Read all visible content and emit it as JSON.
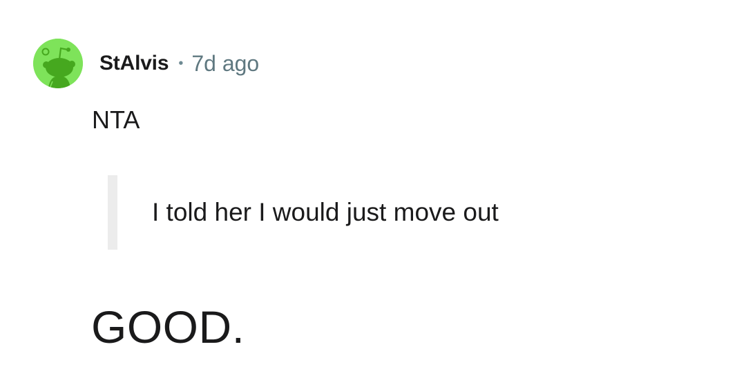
{
  "comment": {
    "avatar_icon": "reddit-snoo-avatar-icon",
    "avatar_color": "#7ee35a",
    "author": "StAlvis",
    "separator": "•",
    "timestamp": "7d ago",
    "body": {
      "line1": "NTA",
      "quote": "I told her I would just move out",
      "line2": "GOOD."
    }
  },
  "colors": {
    "text": "#1a1a1b",
    "meta": "#5f7880",
    "quote_bar": "#ececec"
  }
}
